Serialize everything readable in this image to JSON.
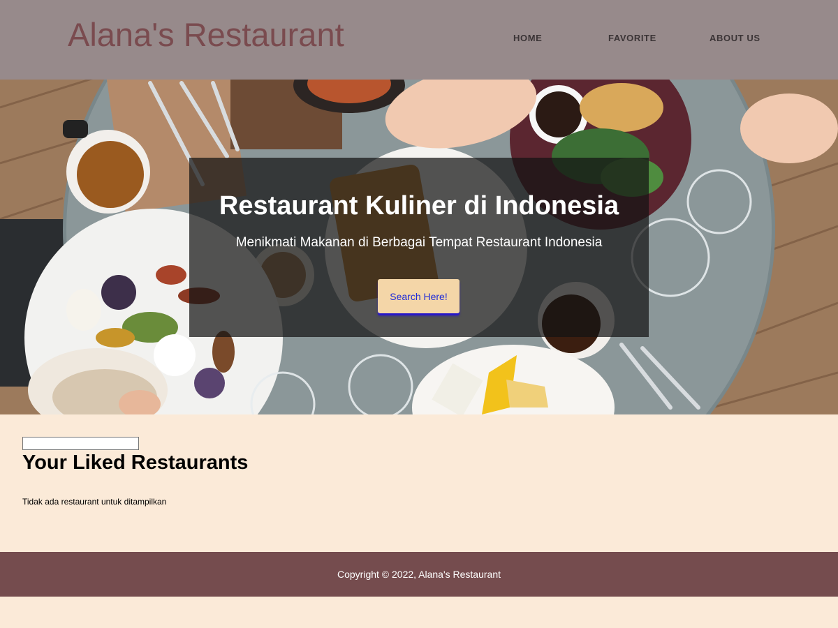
{
  "header": {
    "brand": "Alana's Restaurant",
    "nav": [
      {
        "label": "HOME"
      },
      {
        "label": "FAVORITE"
      },
      {
        "label": "ABOUT US"
      }
    ]
  },
  "hero": {
    "title": "Restaurant Kuliner di Indonesia",
    "subtitle": "Menikmati Makanan di Berbagai Tempat Restaurant Indonesia",
    "button_label": "Search Here!"
  },
  "content": {
    "input_value": "",
    "title": "Your Liked Restaurants",
    "empty_message": "Tidak ada restaurant untuk ditampilkan"
  },
  "footer": {
    "copyright": "Copyright © 2022, Alana's Restaurant"
  },
  "colors": {
    "header_bg": "#978a8b",
    "brand": "#7a4b4f",
    "page_bg": "#fbead8",
    "footer_bg": "#754c4e",
    "button_bg": "#f4d6a8",
    "button_text": "#1e2bd8"
  }
}
